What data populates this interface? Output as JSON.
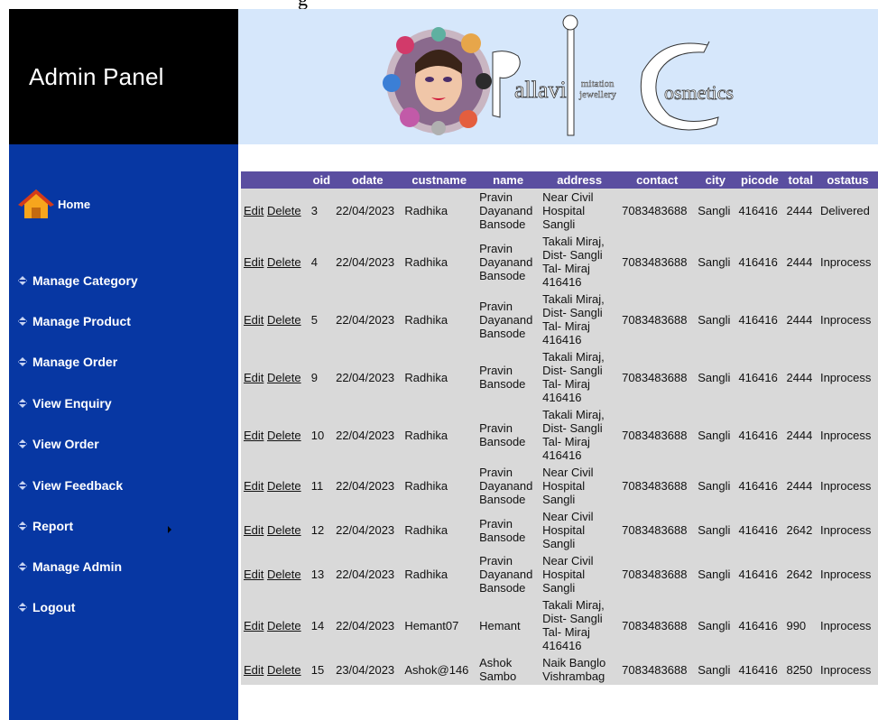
{
  "header": {
    "title": "Admin Panel",
    "cut_text": "g"
  },
  "banner": {
    "logo_text": [
      "P",
      "allavi",
      "i",
      "mitation",
      "jewellery",
      "C",
      "osmetics"
    ]
  },
  "sidebar": {
    "home": "Home",
    "items": [
      {
        "label": "Manage Category"
      },
      {
        "label": "Manage Product"
      },
      {
        "label": "Manage Order"
      },
      {
        "label": "View Enquiry"
      },
      {
        "label": "View Order"
      },
      {
        "label": "View Feedback"
      },
      {
        "label": "Report"
      },
      {
        "label": "Manage Admin"
      },
      {
        "label": "Logout"
      }
    ]
  },
  "table": {
    "columns": [
      "oid",
      "odate",
      "custname",
      "name",
      "address",
      "contact",
      "city",
      "picode",
      "total",
      "ostatus"
    ],
    "edit_label": "Edit",
    "delete_label": "Delete",
    "rows": [
      {
        "oid": "3",
        "odate": "22/04/2023",
        "custname": "Radhika",
        "name": [
          "Pravin",
          "Dayanand",
          "Bansode"
        ],
        "address": [
          "Near Civil",
          "Hospital",
          "Sangli"
        ],
        "contact": "7083483688",
        "city": "Sangli",
        "picode": "416416",
        "total": "2444",
        "ostatus": "Delivered"
      },
      {
        "oid": "4",
        "odate": "22/04/2023",
        "custname": "Radhika",
        "name": [
          "Pravin",
          "Dayanand",
          "Bansode"
        ],
        "address": [
          "Takali Miraj,",
          "Dist- Sangli",
          "Tal- Miraj",
          "416416"
        ],
        "contact": "7083483688",
        "city": "Sangli",
        "picode": "416416",
        "total": "2444",
        "ostatus": "Inprocess"
      },
      {
        "oid": "5",
        "odate": "22/04/2023",
        "custname": "Radhika",
        "name": [
          "Pravin",
          "Dayanand",
          "Bansode"
        ],
        "address": [
          "Takali Miraj,",
          "Dist- Sangli",
          "Tal- Miraj",
          "416416"
        ],
        "contact": "7083483688",
        "city": "Sangli",
        "picode": "416416",
        "total": "2444",
        "ostatus": "Inprocess"
      },
      {
        "oid": "9",
        "odate": "22/04/2023",
        "custname": "Radhika",
        "name": [
          "Pravin",
          "Bansode"
        ],
        "address": [
          "Takali Miraj,",
          "Dist- Sangli",
          "Tal- Miraj",
          "416416"
        ],
        "contact": "7083483688",
        "city": "Sangli",
        "picode": "416416",
        "total": "2444",
        "ostatus": "Inprocess"
      },
      {
        "oid": "10",
        "odate": "22/04/2023",
        "custname": "Radhika",
        "name": [
          "Pravin",
          "Bansode"
        ],
        "address": [
          "Takali Miraj,",
          "Dist- Sangli",
          "Tal- Miraj",
          "416416"
        ],
        "contact": "7083483688",
        "city": "Sangli",
        "picode": "416416",
        "total": "2444",
        "ostatus": "Inprocess"
      },
      {
        "oid": "11",
        "odate": "22/04/2023",
        "custname": "Radhika",
        "name": [
          "Pravin",
          "Dayanand",
          "Bansode"
        ],
        "address": [
          "Near Civil",
          "Hospital",
          "Sangli"
        ],
        "contact": "7083483688",
        "city": "Sangli",
        "picode": "416416",
        "total": "2444",
        "ostatus": "Inprocess"
      },
      {
        "oid": "12",
        "odate": "22/04/2023",
        "custname": "Radhika",
        "name": [
          "Pravin",
          "Bansode"
        ],
        "address": [
          "Near Civil",
          "Hospital",
          "Sangli"
        ],
        "contact": "7083483688",
        "city": "Sangli",
        "picode": "416416",
        "total": "2642",
        "ostatus": "Inprocess"
      },
      {
        "oid": "13",
        "odate": "22/04/2023",
        "custname": "Radhika",
        "name": [
          "Pravin",
          "Dayanand",
          "Bansode"
        ],
        "address": [
          "Near Civil",
          "Hospital",
          "Sangli"
        ],
        "contact": "7083483688",
        "city": "Sangli",
        "picode": "416416",
        "total": "2642",
        "ostatus": "Inprocess"
      },
      {
        "oid": "14",
        "odate": "22/04/2023",
        "custname": "Hemant07",
        "name": [
          "Hemant"
        ],
        "address": [
          "Takali Miraj,",
          "Dist- Sangli",
          "Tal- Miraj",
          "416416"
        ],
        "contact": "7083483688",
        "city": "Sangli",
        "picode": "416416",
        "total": "990",
        "ostatus": "Inprocess"
      },
      {
        "oid": "15",
        "odate": "23/04/2023",
        "custname": "Ashok@146",
        "name": [
          "Ashok",
          "Sambo"
        ],
        "address": [
          "Naik Banglo",
          "Vishrambag"
        ],
        "contact": "7083483688",
        "city": "Sangli",
        "picode": "416416",
        "total": "8250",
        "ostatus": "Inprocess"
      }
    ]
  },
  "colors": {
    "sidebar": "#0737a3",
    "header_bg": "#000000",
    "banner_bg": "#d6e7fb",
    "table_header": "#5a4ea0",
    "table_body": "#d9d9d9"
  },
  "icons": [
    "home-icon",
    "bullet-icon",
    "submenu-arrow-icon",
    "makeup-collage-logo"
  ]
}
